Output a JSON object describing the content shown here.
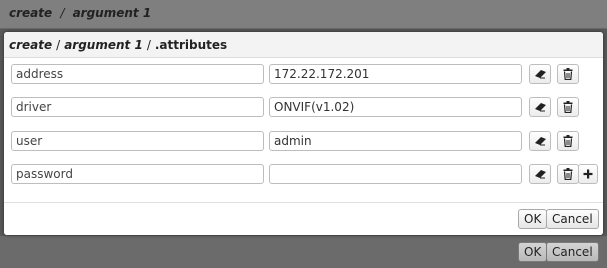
{
  "background_dialog": {
    "breadcrumb": {
      "part1": "create",
      "sep": "/",
      "part2": "argument 1"
    },
    "ok_label": "OK",
    "cancel_label": "Cancel"
  },
  "modal": {
    "breadcrumb": {
      "part1": "create",
      "sep1": "/",
      "part2": "argument 1",
      "sep2": "/",
      "part3": ".attributes"
    },
    "attributes": [
      {
        "key": "address",
        "value": "172.22.172.201"
      },
      {
        "key": "driver",
        "value": "ONVIF(v1.02)"
      },
      {
        "key": "user",
        "value": "admin"
      },
      {
        "key": "password",
        "value": ""
      }
    ],
    "ok_label": "OK",
    "cancel_label": "Cancel"
  },
  "icons": {
    "clear": "eraser-icon",
    "delete": "trash-icon",
    "add": "plus-icon"
  }
}
